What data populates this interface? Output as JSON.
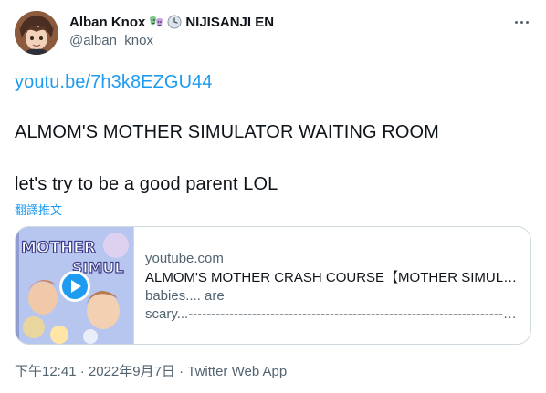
{
  "user": {
    "display_name": "Alban Knox",
    "badges": [
      "masks-emoji",
      "clock-emoji"
    ],
    "affiliation": "NIJISANJI EN",
    "handle": "@alban_knox"
  },
  "tweet": {
    "link": "youtu.be/7h3k8EZGU44",
    "paragraphs": [
      "ALMOM'S MOTHER SIMULATOR WAITING ROOM",
      "let's try to be a good parent LOL"
    ],
    "translate_label": "翻譯推文"
  },
  "card": {
    "domain": "youtube.com",
    "title": "ALMOM'S MOTHER CRASH COURSE【MOTHER SIMULATOR】【NIJISANJI EN | Alban Knox】",
    "description_line1": "babies.... are",
    "description_line2": "scary...------------------------------------------------------------------------------------------------",
    "thumbnail_text": "MOTHER SIMULATOR"
  },
  "footer": {
    "meta": "下午12:41 · 2022年9月7日 · Twitter Web App"
  },
  "colors": {
    "link": "#1d9bf0",
    "secondary_text": "#536471",
    "border": "#cfd9de"
  }
}
